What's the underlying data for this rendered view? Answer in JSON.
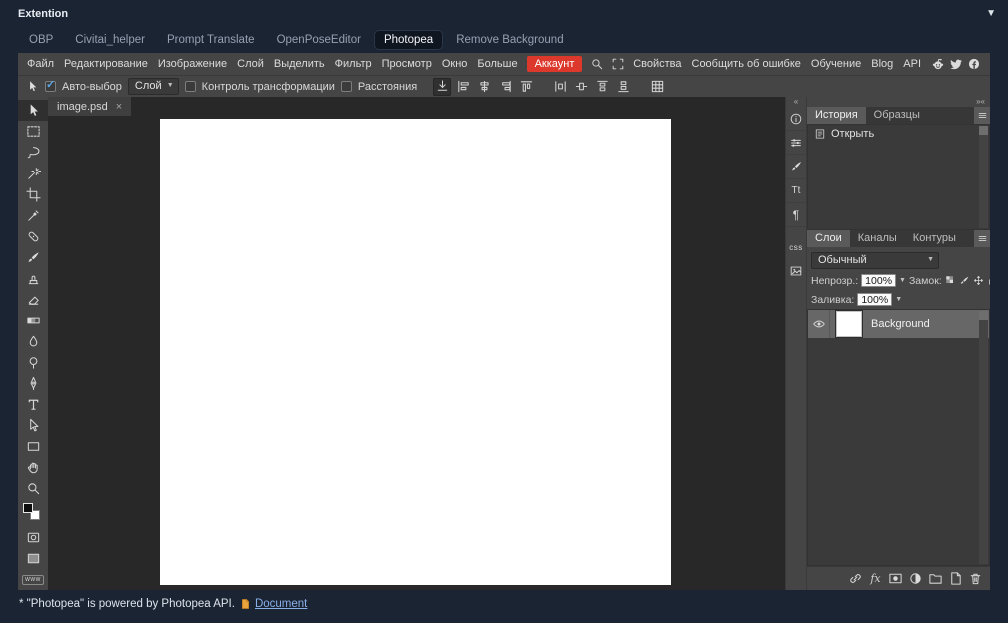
{
  "page": {
    "title": "Extention",
    "accordion_arrow": "▼",
    "tabs": [
      "OBP",
      "Civitai_helper",
      "Prompt Translate",
      "OpenPoseEditor",
      "Photopea",
      "Remove Background"
    ],
    "active_tab": "Photopea",
    "footer": {
      "text": "* \"Photopea\" is powered by Photopea API.",
      "link_label": "Document"
    }
  },
  "photopea": {
    "ui": {
      "dropdown_arrow": "▼",
      "check": "✓"
    },
    "menu": {
      "items": [
        "Файл",
        "Редактирование",
        "Изображение",
        "Слой",
        "Выделить",
        "Фильтр",
        "Просмотр",
        "Окно",
        "Больше"
      ],
      "account": "Аккаунт",
      "icons": [
        "search-icon",
        "fullscreen-icon"
      ],
      "right_items": [
        "Свойства",
        "Сообщить об ошибке",
        "Обучение",
        "Blog",
        "API"
      ],
      "social_icons": [
        "reddit-icon",
        "twitter-icon",
        "facebook-icon"
      ],
      "accent_red": "#dd382c"
    },
    "options_bar": {
      "current_tool": "move",
      "auto_select": {
        "label": "Авто-выбор",
        "checked": true
      },
      "target_dropdown": "Слой",
      "transform_controls": {
        "label": "Контроль трансформации",
        "checked": false
      },
      "distances": {
        "label": "Расстояния",
        "checked": false
      },
      "align_icons": [
        "align-anchor",
        "align-left-edges",
        "align-centers-h",
        "align-right-edges",
        "align-top-edges",
        "distribute-h",
        "distribute-v",
        "distribute-tops",
        "distribute-bottoms",
        "grid-view"
      ]
    },
    "toolbar_tools": [
      "move",
      "rect-select",
      "lasso",
      "magic-wand",
      "crop",
      "eyedropper",
      "healing-brush",
      "brush",
      "clone-stamp",
      "eraser",
      "gradient",
      "blur",
      "dodge",
      "pen",
      "type",
      "path-select",
      "rect-shape",
      "hand",
      "zoom",
      "color-swatches",
      "quick-mask",
      "screen-mode",
      "www"
    ],
    "tools_labels": {
      "www": "WWW"
    },
    "document_tab": {
      "title": "image.psd",
      "close": "×"
    },
    "right_strip_icons": [
      "properties",
      "adjustments",
      "brush",
      "character",
      "paragraph",
      "css",
      "image"
    ],
    "right_strip_labels": {
      "character": "Tt",
      "paragraph": "¶",
      "css": "css"
    },
    "panels": {
      "collapse_left": "«",
      "collapse_right": "»«",
      "history": {
        "tabs": [
          "История",
          "Образцы"
        ],
        "active": "История",
        "entries": [
          "Открыть"
        ]
      },
      "layers": {
        "tabs": [
          "Слои",
          "Каналы",
          "Контуры"
        ],
        "active": "Слои",
        "blend_mode": "Обычный",
        "opacity_label": "Непрозр.:",
        "opacity_value": "100%",
        "lock_label": "Замок:",
        "lock_icons": [
          "lock-transparency",
          "lock-pixels",
          "lock-position",
          "lock-all"
        ],
        "fill_label": "Заливка:",
        "fill_value": "100%",
        "items": [
          {
            "name": "Background",
            "selected": true,
            "visible": true
          }
        ],
        "effects_label": "fx",
        "bottom_icons": [
          "link",
          "effects",
          "mask",
          "adjustment",
          "folder",
          "new-layer",
          "delete"
        ]
      }
    }
  }
}
